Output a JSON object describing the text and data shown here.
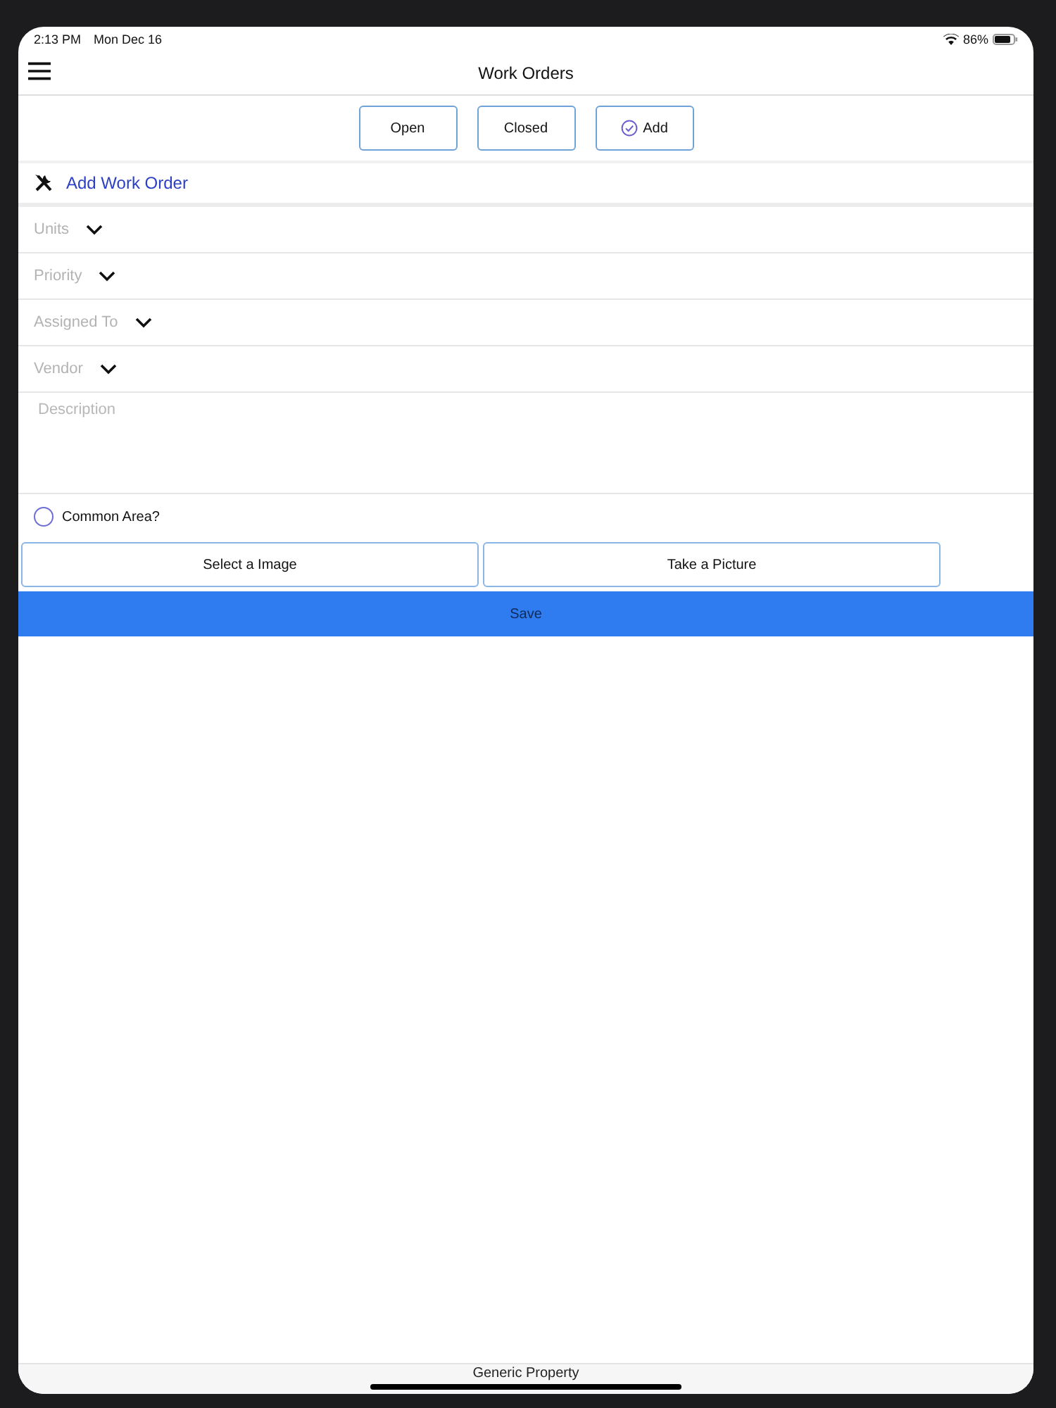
{
  "status_bar": {
    "time": "2:13 PM",
    "date": "Mon Dec 16",
    "battery": "86%"
  },
  "nav": {
    "title": "Work Orders"
  },
  "segments": [
    {
      "label": "Open",
      "kind": "plain"
    },
    {
      "label": "Closed",
      "kind": "plain"
    },
    {
      "label": "Add",
      "kind": "check"
    }
  ],
  "section": {
    "title": "Add Work Order"
  },
  "fields": [
    {
      "kind": "select",
      "placeholder": "Units"
    },
    {
      "kind": "select",
      "placeholder": "Priority"
    },
    {
      "kind": "select",
      "placeholder": "Assigned To"
    },
    {
      "kind": "select",
      "placeholder": "Vendor"
    },
    {
      "kind": "textarea",
      "placeholder": "Description"
    }
  ],
  "common_area": {
    "label": "Common Area?",
    "checked": false
  },
  "image_buttons": [
    "Select a Image",
    "Take a Picture"
  ],
  "save_button": "Save",
  "footer": "Generic Property"
}
